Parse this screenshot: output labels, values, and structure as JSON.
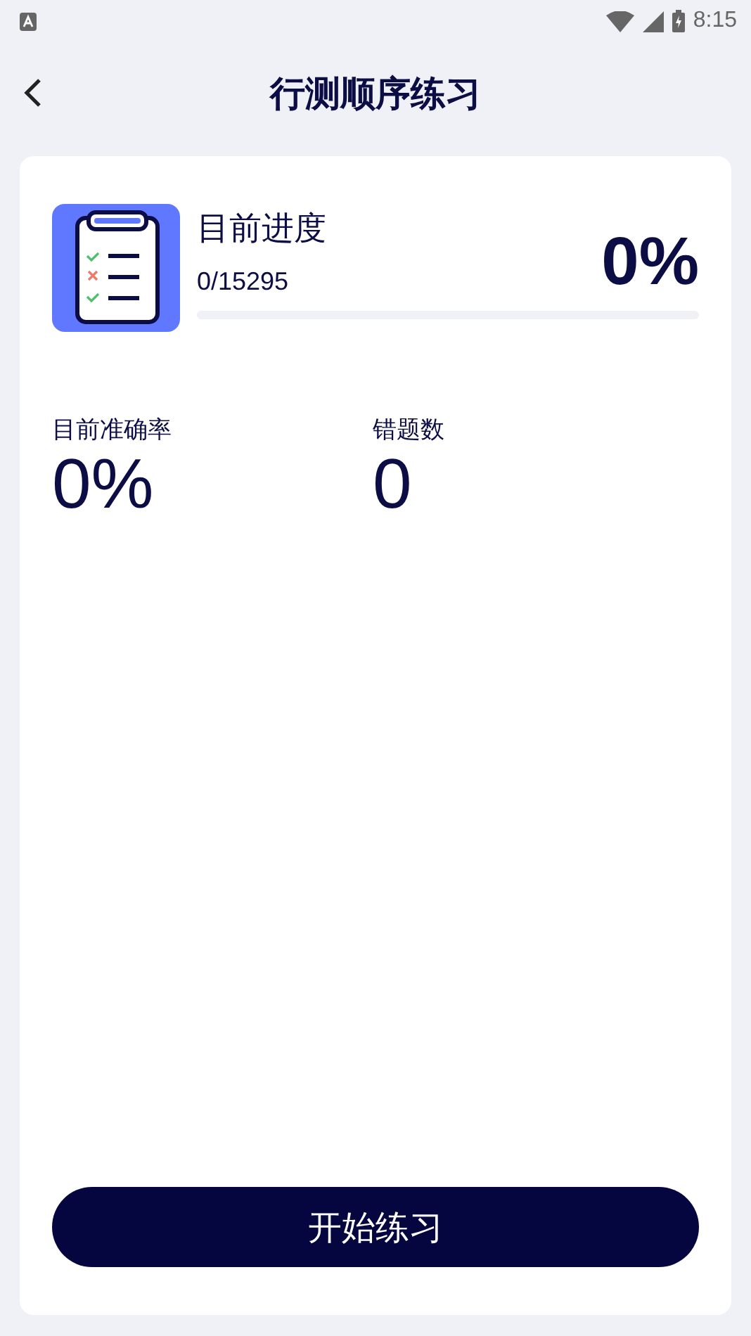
{
  "status_bar": {
    "time": "8:15"
  },
  "header": {
    "title": "行测顺序练习"
  },
  "progress": {
    "label": "目前进度",
    "count": "0/15295",
    "percent": "0%",
    "level": 0
  },
  "stats": [
    {
      "label": "目前准确率",
      "value": "0%"
    },
    {
      "label": "错题数",
      "value": "0"
    }
  ],
  "start_button": "开始练习"
}
